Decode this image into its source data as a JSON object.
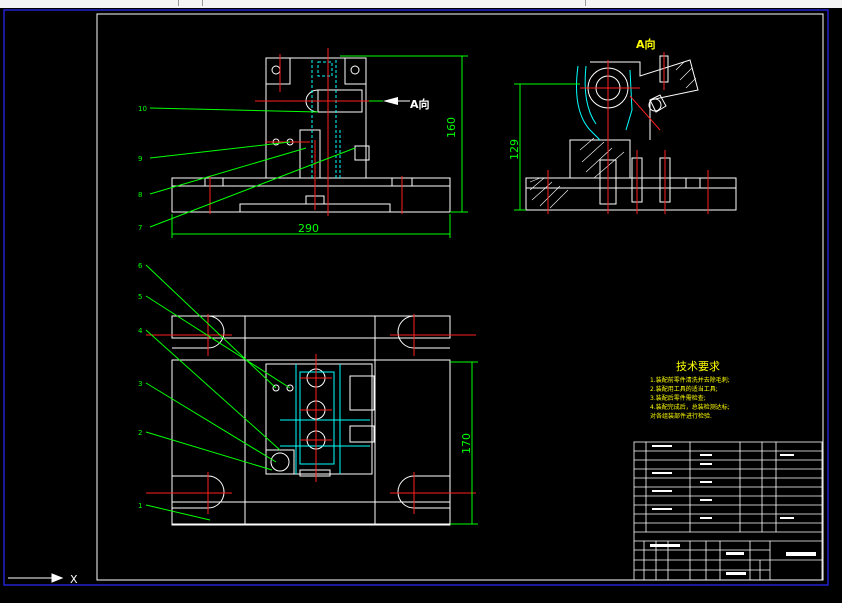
{
  "dimensions": {
    "front_height": "160",
    "front_width": "290",
    "side_height": "129",
    "plan_height": "170"
  },
  "view_labels": {
    "arrow_direction": "A向",
    "side_view_title": "A向"
  },
  "part_numbers": [
    "10",
    "9",
    "8",
    "7",
    "6",
    "5",
    "4",
    "3",
    "2",
    "1"
  ],
  "technical_requirements": {
    "title": "技术要求",
    "lines": [
      "1.装配前零件清洗并去除毛刺;",
      "2.装配用工具的适当工具;",
      "3.装配后零件需检查;",
      "4.装配完成后，总装检测达标;",
      "对各组装部件进行检验."
    ]
  },
  "ucs": {
    "x_label": "X"
  },
  "colors": {
    "background": "#000000",
    "border": "#2a2aff",
    "outline": "#ffffff",
    "centerline": "#ff2020",
    "dimension": "#00ff00",
    "leader": "#00ff00",
    "hidden": "#00ffff",
    "text": "#ffff00"
  }
}
